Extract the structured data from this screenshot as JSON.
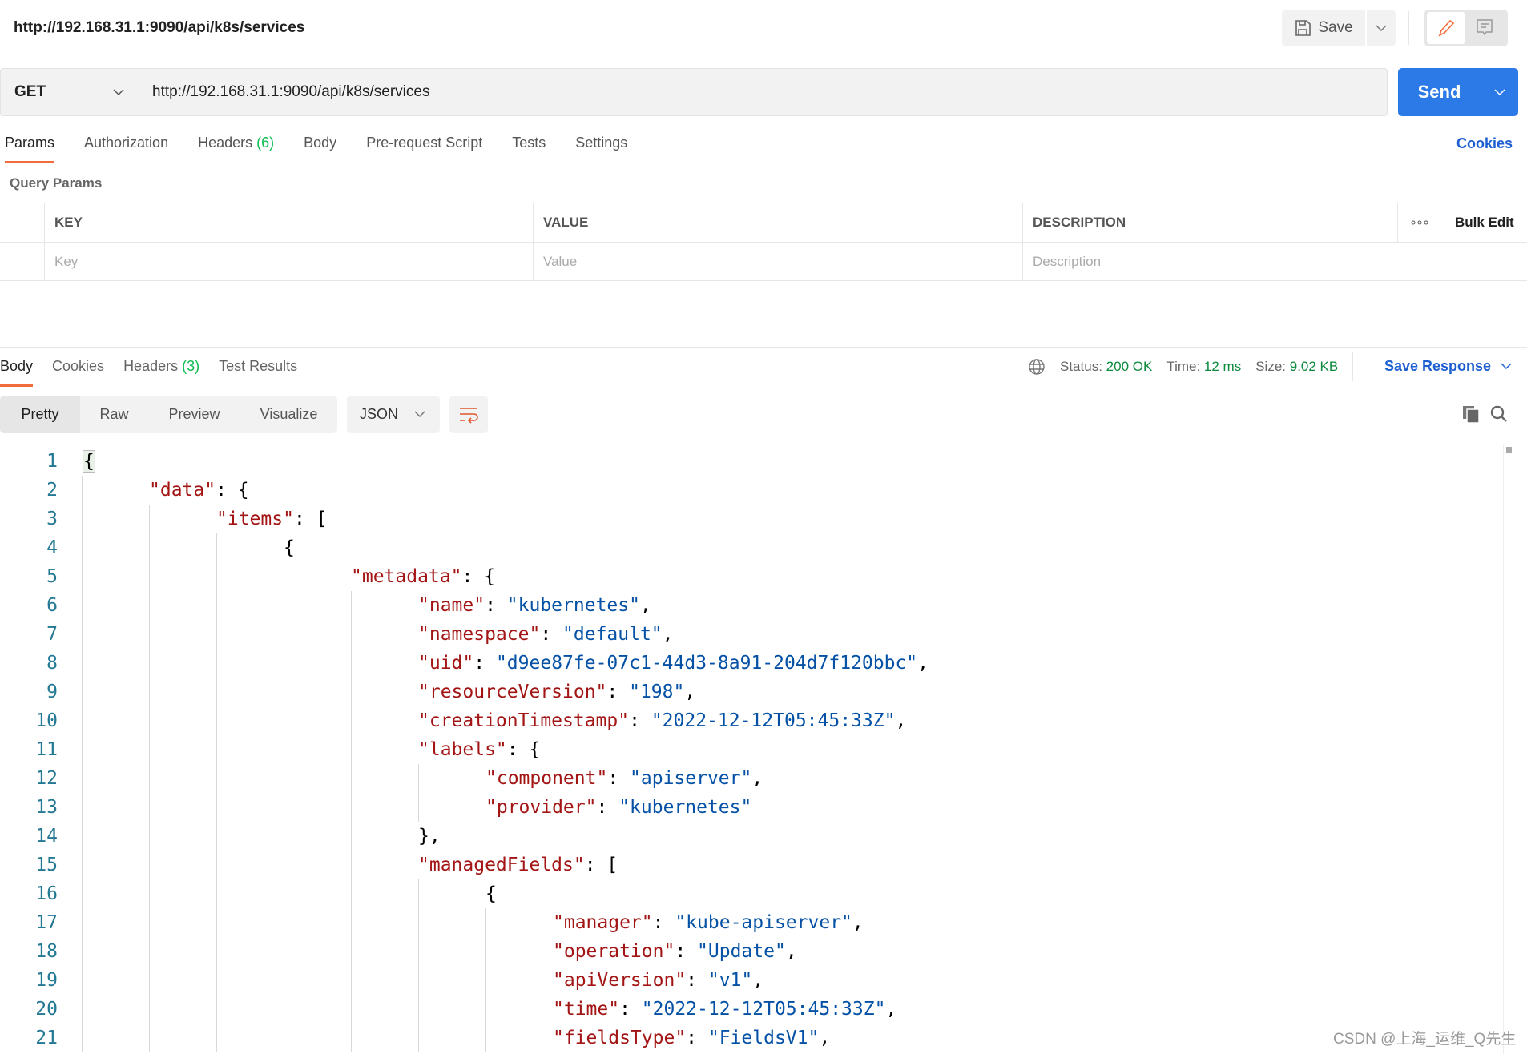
{
  "header": {
    "title": "http://192.168.31.1:9090/api/k8s/services",
    "save_label": "Save"
  },
  "request": {
    "method": "GET",
    "url": "http://192.168.31.1:9090/api/k8s/services",
    "send_label": "Send"
  },
  "tabs": [
    {
      "label": "Params"
    },
    {
      "label": "Authorization"
    },
    {
      "label": "Headers",
      "count": "(6)"
    },
    {
      "label": "Body"
    },
    {
      "label": "Pre-request Script"
    },
    {
      "label": "Tests"
    },
    {
      "label": "Settings"
    }
  ],
  "cookies_link": "Cookies",
  "query_params": {
    "title": "Query Params",
    "headers": [
      "KEY",
      "VALUE",
      "DESCRIPTION",
      "Bulk Edit"
    ],
    "placeholders": [
      "Key",
      "Value",
      "Description"
    ]
  },
  "response": {
    "tabs": [
      {
        "label": "Body"
      },
      {
        "label": "Cookies"
      },
      {
        "label": "Headers",
        "count": "(3)"
      },
      {
        "label": "Test Results"
      }
    ],
    "status_label": "Status:",
    "status": "200 OK",
    "time_label": "Time:",
    "time": "12 ms",
    "size_label": "Size:",
    "size": "9.02 KB",
    "save_response": "Save Response",
    "views": [
      "Pretty",
      "Raw",
      "Preview",
      "Visualize"
    ],
    "format": "JSON"
  },
  "code_lines": [
    {
      "n": "1",
      "indent": 0,
      "text": "{"
    },
    {
      "n": "2",
      "indent": 1,
      "key": "\"data\"",
      "text": ": {"
    },
    {
      "n": "3",
      "indent": 2,
      "key": "\"items\"",
      "text": ": ["
    },
    {
      "n": "4",
      "indent": 3,
      "text": "{"
    },
    {
      "n": "5",
      "indent": 4,
      "key": "\"metadata\"",
      "text": ": {"
    },
    {
      "n": "6",
      "indent": 5,
      "key": "\"name\"",
      "text": ": ",
      "val": "\"kubernetes\"",
      "tail": ","
    },
    {
      "n": "7",
      "indent": 5,
      "key": "\"namespace\"",
      "text": ": ",
      "val": "\"default\"",
      "tail": ","
    },
    {
      "n": "8",
      "indent": 5,
      "key": "\"uid\"",
      "text": ": ",
      "val": "\"d9ee87fe-07c1-44d3-8a91-204d7f120bbc\"",
      "tail": ","
    },
    {
      "n": "9",
      "indent": 5,
      "key": "\"resourceVersion\"",
      "text": ": ",
      "val": "\"198\"",
      "tail": ","
    },
    {
      "n": "10",
      "indent": 5,
      "key": "\"creationTimestamp\"",
      "text": ": ",
      "val": "\"2022-12-12T05:45:33Z\"",
      "tail": ","
    },
    {
      "n": "11",
      "indent": 5,
      "key": "\"labels\"",
      "text": ": {"
    },
    {
      "n": "12",
      "indent": 6,
      "key": "\"component\"",
      "text": ": ",
      "val": "\"apiserver\"",
      "tail": ","
    },
    {
      "n": "13",
      "indent": 6,
      "key": "\"provider\"",
      "text": ": ",
      "val": "\"kubernetes\""
    },
    {
      "n": "14",
      "indent": 5,
      "text": "},"
    },
    {
      "n": "15",
      "indent": 5,
      "key": "\"managedFields\"",
      "text": ": ["
    },
    {
      "n": "16",
      "indent": 6,
      "text": "{"
    },
    {
      "n": "17",
      "indent": 7,
      "key": "\"manager\"",
      "text": ": ",
      "val": "\"kube-apiserver\"",
      "tail": ","
    },
    {
      "n": "18",
      "indent": 7,
      "key": "\"operation\"",
      "text": ": ",
      "val": "\"Update\"",
      "tail": ","
    },
    {
      "n": "19",
      "indent": 7,
      "key": "\"apiVersion\"",
      "text": ": ",
      "val": "\"v1\"",
      "tail": ","
    },
    {
      "n": "20",
      "indent": 7,
      "key": "\"time\"",
      "text": ": ",
      "val": "\"2022-12-12T05:45:33Z\"",
      "tail": ","
    },
    {
      "n": "21",
      "indent": 7,
      "key": "\"fieldsType\"",
      "text": ": ",
      "val": "\"FieldsV1\"",
      "tail": ","
    }
  ],
  "watermark": "CSDN @上海_运维_Q先生",
  "colors": {
    "accent": "#f26b3a",
    "send": "#2b7ae8",
    "link": "#1d5fd0",
    "success": "#0c8a3d",
    "json_key": "#a31515",
    "json_string": "#0451a5"
  }
}
